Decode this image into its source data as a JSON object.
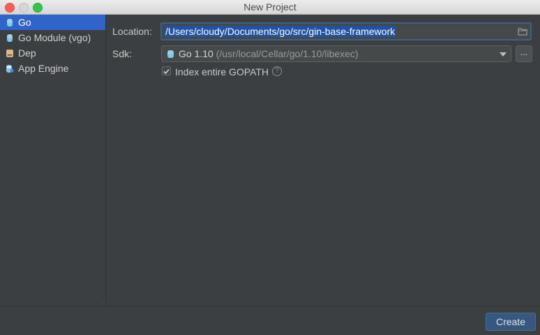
{
  "window": {
    "title": "New Project"
  },
  "sidebar": {
    "items": [
      {
        "label": "Go",
        "icon": "gopher-icon",
        "selected": true
      },
      {
        "label": "Go Module (vgo)",
        "icon": "gopher-icon",
        "selected": false
      },
      {
        "label": "Dep",
        "icon": "dep-icon",
        "selected": false
      },
      {
        "label": "App Engine",
        "icon": "app-engine-icon",
        "selected": false
      }
    ]
  },
  "form": {
    "location_label": "Location:",
    "location_value": "/Users/cloudy/Documents/go/src/gin-base-framework",
    "sdk_label": "Sdk:",
    "sdk_name": "Go 1.10",
    "sdk_path": "(/usr/local/Cellar/go/1.10/libexec)",
    "browse_label": "...",
    "index_gopath_label": "Index entire GOPATH",
    "index_gopath_checked": true,
    "help_glyph": "?"
  },
  "footer": {
    "create_label": "Create"
  },
  "colors": {
    "selection": "#2f65ca",
    "text_selection": "#2152a6",
    "focus_border": "#3d6185",
    "primary_button": "#365880"
  }
}
